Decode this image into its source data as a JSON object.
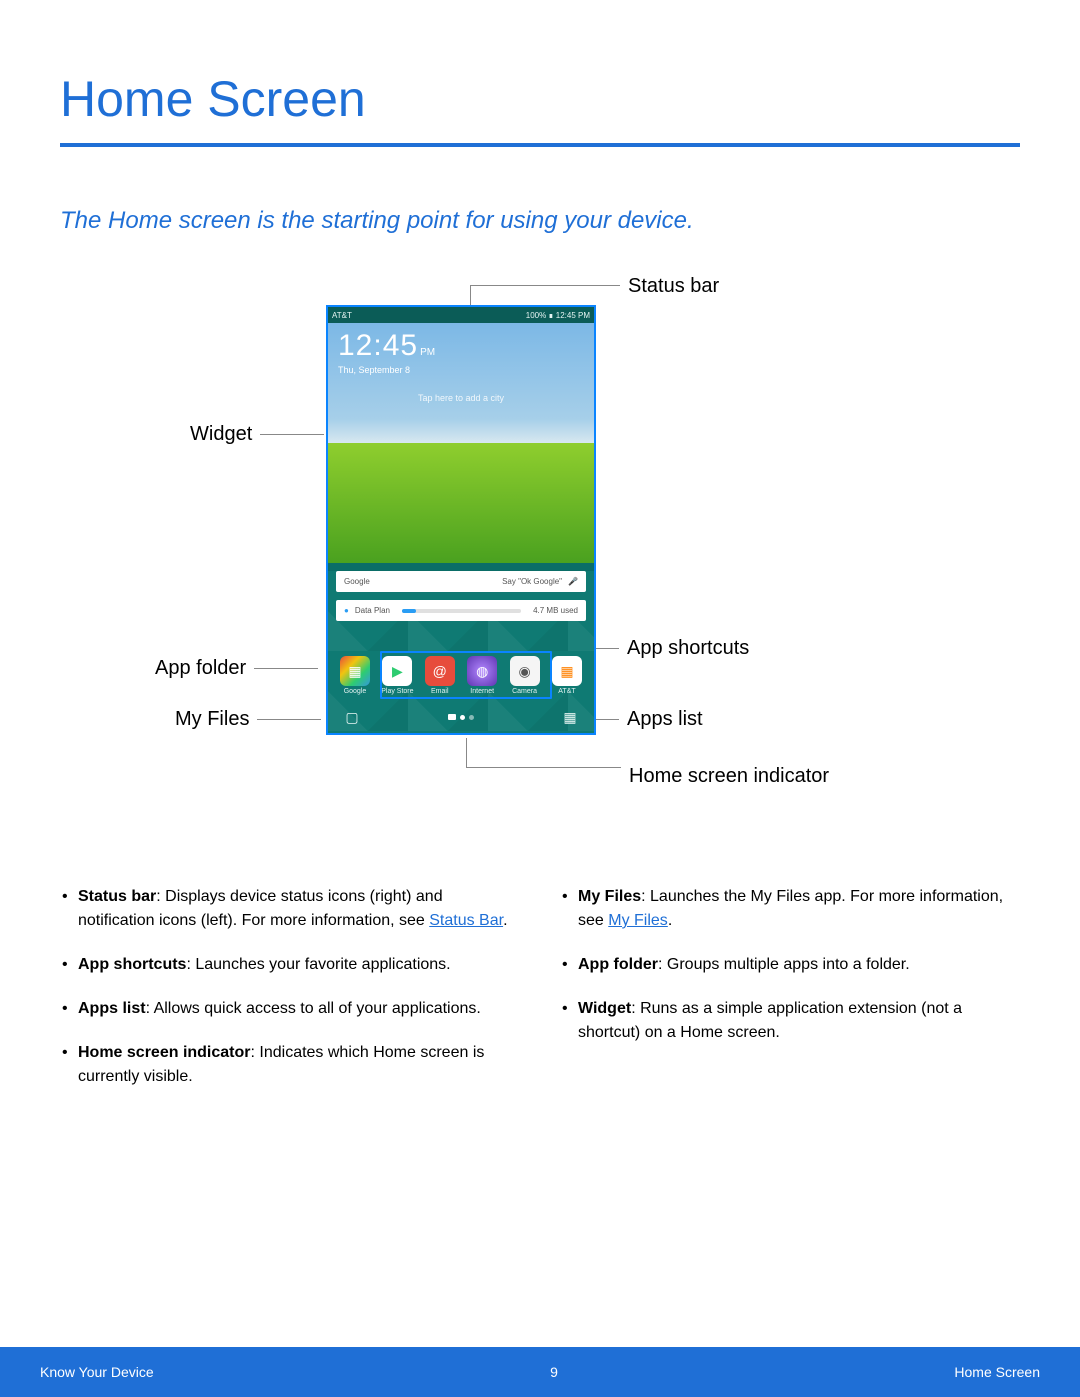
{
  "title": "Home Screen",
  "intro": "The Home screen is the starting point for using your device.",
  "device": {
    "status_left": "AT&T",
    "status_right": "100% ∎ 12:45 PM",
    "clock_time": "12:45",
    "clock_ampm": "PM",
    "clock_date": "Thu, September 8",
    "tap_hint": "Tap here to add a city",
    "google_card_left": "Google",
    "google_card_right": "Say \"Ok Google\"",
    "dataplan_label": "Data Plan",
    "dataplan_used": "4.7 MB used",
    "dock": [
      {
        "label": "Google"
      },
      {
        "label": "Play Store"
      },
      {
        "label": "Email"
      },
      {
        "label": "Internet"
      },
      {
        "label": "Camera"
      },
      {
        "label": "AT&T"
      }
    ]
  },
  "callouts": {
    "status_bar": "Status bar",
    "widget": "Widget",
    "app_shortcuts": "App shortcuts",
    "app_folder": "App folder",
    "my_files": "My Files",
    "apps_list": "Apps list",
    "home_indicator": "Home screen indicator"
  },
  "bullets_left": [
    {
      "b": "Status bar",
      "text": ": Displays device status icons (right) and notification icons (left). For more information, see ",
      "link": "Status Bar",
      "after": "."
    },
    {
      "b": "App shortcuts",
      "text": ": Launches your favorite applications."
    },
    {
      "b": "Apps list",
      "text": ": Allows quick access to all of your applications."
    },
    {
      "b": "Home screen indicator",
      "text": ": Indicates which Home screen is currently visible."
    }
  ],
  "bullets_right": [
    {
      "b": "My Files",
      "text": ": Launches the My Files app. For more information, see ",
      "link": "My Files",
      "after": "."
    },
    {
      "b": "App folder",
      "text": ": Groups multiple apps into a folder."
    },
    {
      "b": "Widget",
      "text": ": Runs as a simple application extension (not a shortcut) on a Home screen."
    }
  ],
  "footer": {
    "left": "Know Your Device",
    "center": "9",
    "right": "Home Screen"
  }
}
